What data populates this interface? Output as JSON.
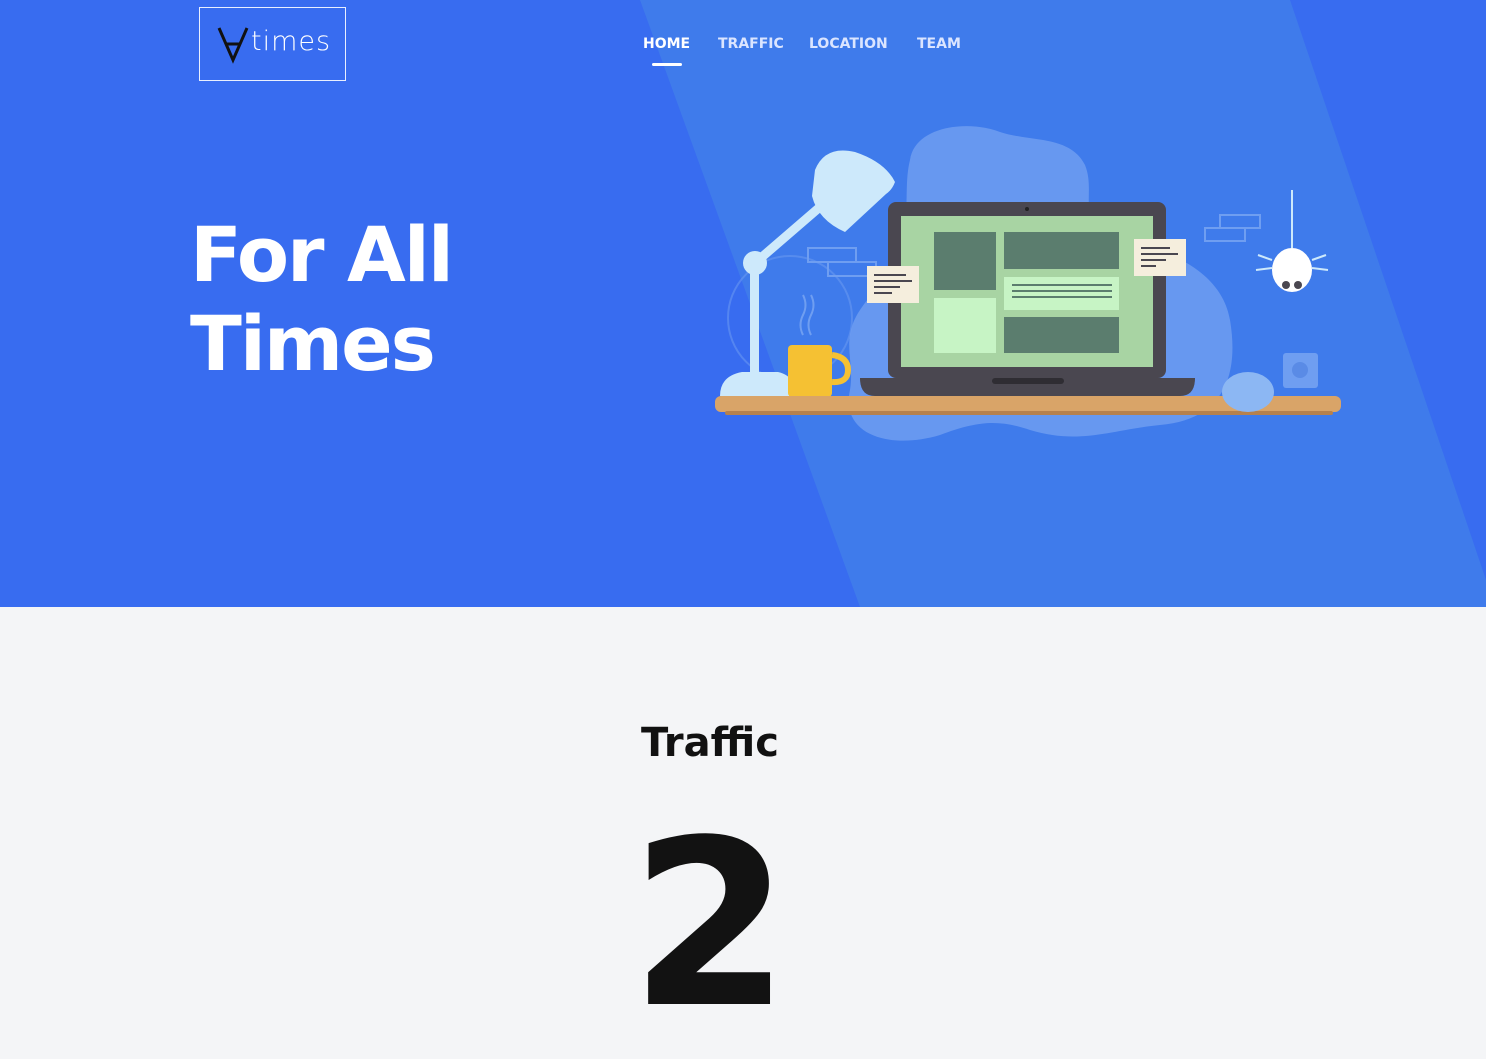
{
  "brand": {
    "logo_text": "times",
    "logo_mark_icon": "forall-icon"
  },
  "nav": {
    "items": [
      {
        "label": "HOME",
        "active": true
      },
      {
        "label": "TRAFFIC",
        "active": false
      },
      {
        "label": "LOCATION",
        "active": false
      },
      {
        "label": "TEAM",
        "active": false
      }
    ]
  },
  "hero": {
    "title_line_1": "For All",
    "title_line_2": "Times",
    "illustration_icon": "desk-laptop-illustration"
  },
  "traffic": {
    "title": "Traffic",
    "value": "2"
  },
  "colors": {
    "hero_bg": "#386cf0",
    "beam": "#4a8ae6",
    "page_bg": "#f4f5f7",
    "text_dark": "#111111"
  }
}
